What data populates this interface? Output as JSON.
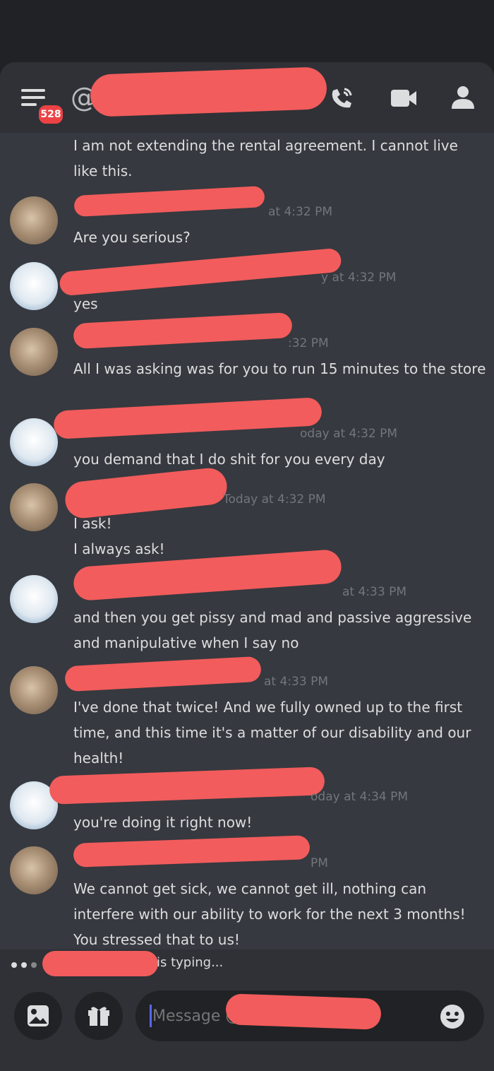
{
  "header": {
    "badge_count": "528",
    "at_symbol": "@"
  },
  "messages": [
    {
      "id": "m0",
      "timestamp": "",
      "lines": [
        "I am not extending the rental agreement. I cannot live like this."
      ]
    },
    {
      "id": "m1",
      "timestamp": "at 4:32 PM",
      "lines": [
        "Are you serious?"
      ]
    },
    {
      "id": "m2",
      "timestamp": "y at 4:32 PM",
      "lines": [
        "yes"
      ]
    },
    {
      "id": "m3",
      "timestamp": ":32 PM",
      "lines": [
        "All I was asking was for you to run 15 minutes to the store"
      ]
    },
    {
      "id": "m4",
      "timestamp": "oday at 4:32 PM",
      "lines": [
        "you demand that I do shit for you every day"
      ]
    },
    {
      "id": "m5",
      "timestamp": "Today at 4:32 PM",
      "lines": [
        "I ask!",
        "I always ask!"
      ]
    },
    {
      "id": "m6",
      "timestamp": "at 4:33 PM",
      "lines": [
        "and then you get pissy and mad and passive aggressive and manipulative when I say no"
      ]
    },
    {
      "id": "m7",
      "timestamp": "at 4:33 PM",
      "lines": [
        "I've done that twice! And we fully owned up to the first time, and this time it's a matter of our disability and our health!"
      ]
    },
    {
      "id": "m8",
      "timestamp": "oday at 4:34 PM",
      "lines": [
        "you're doing it right now!"
      ]
    },
    {
      "id": "m9",
      "timestamp": "PM",
      "lines": [
        "We cannot get sick, we cannot get ill, nothing can interfere with our ability to work for the next 3 months! You stressed that to us!"
      ]
    }
  ],
  "typing": {
    "text": "is typing..."
  },
  "composer": {
    "placeholder": "Message @"
  },
  "colors": {
    "background": "#36393f",
    "header": "#2f3136",
    "redaction": "#f25c5c",
    "accent": "#5865f2",
    "badge": "#ed4245"
  }
}
